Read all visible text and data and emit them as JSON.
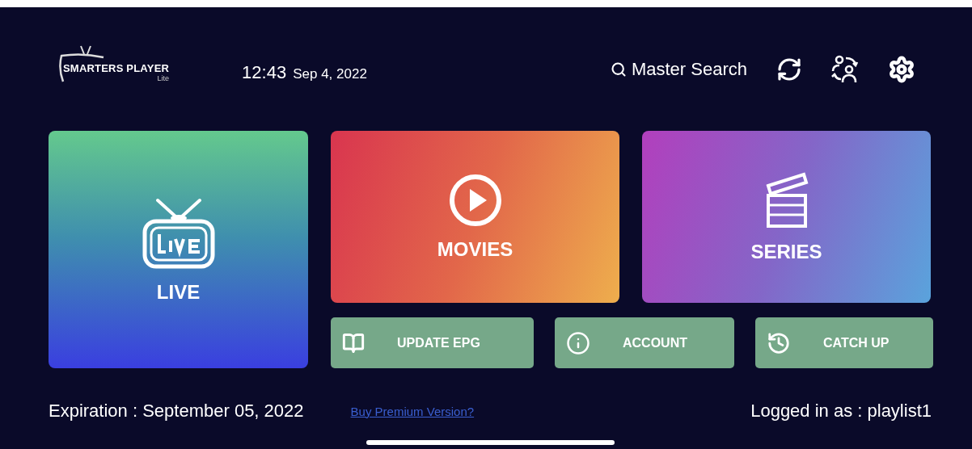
{
  "header": {
    "logo": {
      "title": "SMARTERS PLAYER",
      "subtitle": "Lite"
    },
    "time": "12:43",
    "date": "Sep 4, 2022",
    "search_label": "Master Search"
  },
  "tiles": [
    {
      "kind": "live",
      "label": "LIVE"
    },
    {
      "kind": "movies",
      "label": "MOVIES"
    },
    {
      "kind": "series",
      "label": "SERIES"
    }
  ],
  "actions": [
    {
      "kind": "epg",
      "label": "UPDATE EPG"
    },
    {
      "kind": "account",
      "label": "ACCOUNT"
    },
    {
      "kind": "catchup",
      "label": "CATCH UP"
    }
  ],
  "footer": {
    "expiration": "Expiration : September 05, 2022",
    "premium_link": "Buy Premium Version?",
    "logged_in": "Logged in as : playlist1"
  }
}
